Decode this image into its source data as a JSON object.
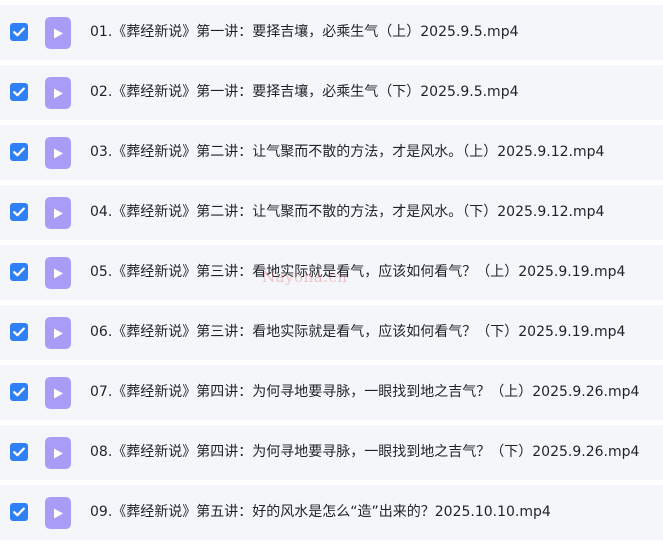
{
  "files": [
    {
      "name": "01.《葬经新说》第一讲：要择吉壤，必乘生气（上）2025.9.5.mp4",
      "checked": true,
      "icon": "video-file-icon"
    },
    {
      "name": "02.《葬经新说》第一讲：要择吉壤，必乘生气（下）2025.9.5.mp4",
      "checked": true,
      "icon": "video-file-icon"
    },
    {
      "name": "03.《葬经新说》第二讲：让气聚而不散的方法，才是风水。（上）2025.9.12.mp4",
      "checked": true,
      "icon": "video-file-icon"
    },
    {
      "name": "04.《葬经新说》第二讲：让气聚而不散的方法，才是风水。（下）2025.9.12.mp4",
      "checked": true,
      "icon": "video-file-icon"
    },
    {
      "name": "05.《葬经新说》第三讲：看地实际就是看气，应该如何看气？（上）2025.9.19.mp4",
      "checked": true,
      "icon": "video-file-icon"
    },
    {
      "name": "06.《葬经新说》第三讲：看地实际就是看气，应该如何看气？（下）2025.9.19.mp4",
      "checked": true,
      "icon": "video-file-icon"
    },
    {
      "name": "07.《葬经新说》第四讲：为何寻地要寻脉，一眼找到地之吉气？（上）2025.9.26.mp4",
      "checked": true,
      "icon": "video-file-icon"
    },
    {
      "name": "08.《葬经新说》第四讲：为何寻地要寻脉，一眼找到地之吉气？（下）2025.9.26.mp4",
      "checked": true,
      "icon": "video-file-icon"
    },
    {
      "name": "09.《葬经新说》第五讲：好的风水是怎么“造”出来的？2025.10.10.mp4",
      "checked": true,
      "icon": "video-file-icon"
    }
  ],
  "watermark": "Nayoha.cn",
  "colors": {
    "row_background": "#f5f6fa",
    "checkbox": "#2f80f5",
    "video_icon": "#a99cf7",
    "text": "#1f2329"
  }
}
